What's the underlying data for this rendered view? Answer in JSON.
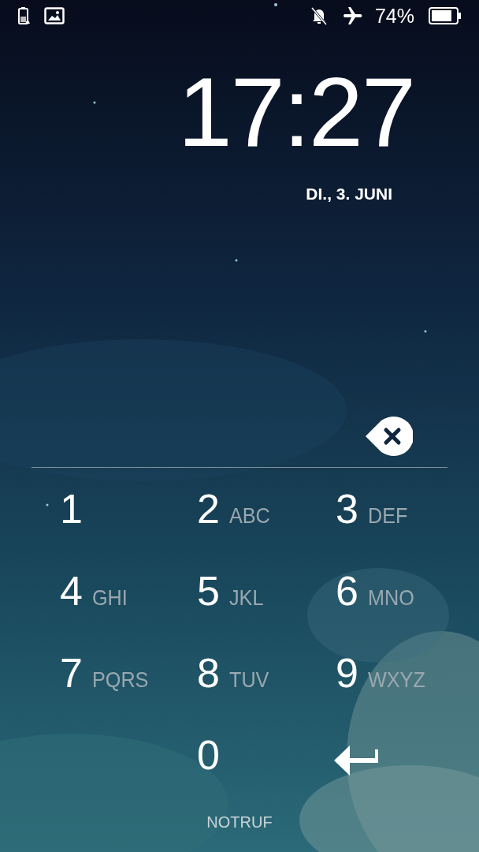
{
  "status_bar": {
    "battery_percent": "74%"
  },
  "clock": {
    "time": "17:27",
    "date": "DI., 3. JUNI"
  },
  "keypad": {
    "rows": [
      [
        {
          "kind": "digit",
          "digit": "1"
        },
        {
          "kind": "digit",
          "digit": "2",
          "letters": "ABC"
        },
        {
          "kind": "digit",
          "digit": "3",
          "letters": "DEF"
        }
      ],
      [
        {
          "kind": "digit",
          "digit": "4",
          "letters": "GHI"
        },
        {
          "kind": "digit",
          "digit": "5",
          "letters": "JKL"
        },
        {
          "kind": "digit",
          "digit": "6",
          "letters": "MNO"
        }
      ],
      [
        {
          "kind": "digit",
          "digit": "7",
          "letters": "PQRS"
        },
        {
          "kind": "digit",
          "digit": "8",
          "letters": "TUV"
        },
        {
          "kind": "digit",
          "digit": "9",
          "letters": "WXYZ"
        }
      ],
      [
        {
          "kind": "blank"
        },
        {
          "kind": "digit",
          "digit": "0"
        },
        {
          "kind": "enter"
        }
      ]
    ]
  },
  "emergency_button": "NOTRUF"
}
